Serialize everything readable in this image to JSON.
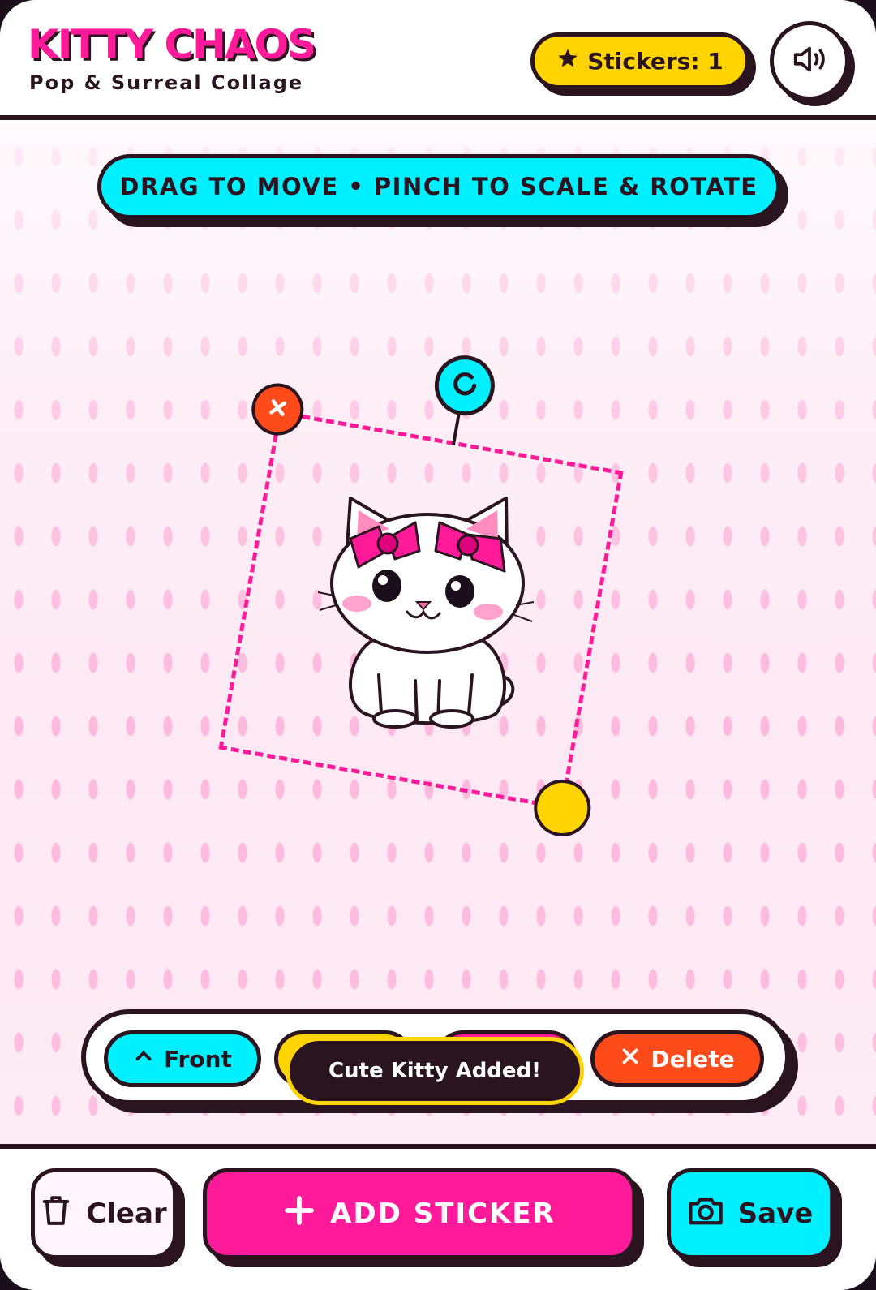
{
  "header": {
    "title": "KITTY CHAOS",
    "subtitle": "Pop & Surreal Collage",
    "stickers_label": "Stickers: 1",
    "sound_icon": "speaker-icon"
  },
  "canvas": {
    "hint": "DRAG TO MOVE • PINCH TO SCALE & ROTATE",
    "sticker_name": "Cute Kitty"
  },
  "toolbar": {
    "front_label": "Front",
    "delete_label": "Delete"
  },
  "toast": {
    "message": "Cute Kitty Added!"
  },
  "bottom": {
    "clear_label": "Clear",
    "add_label": "ADD STICKER",
    "save_label": "Save"
  },
  "colors": {
    "accent_pink": "#ff1a9a",
    "accent_cyan": "#00f0ff",
    "accent_yellow": "#ffd400",
    "accent_orange": "#ff4a1a",
    "ink": "#2a1420"
  }
}
